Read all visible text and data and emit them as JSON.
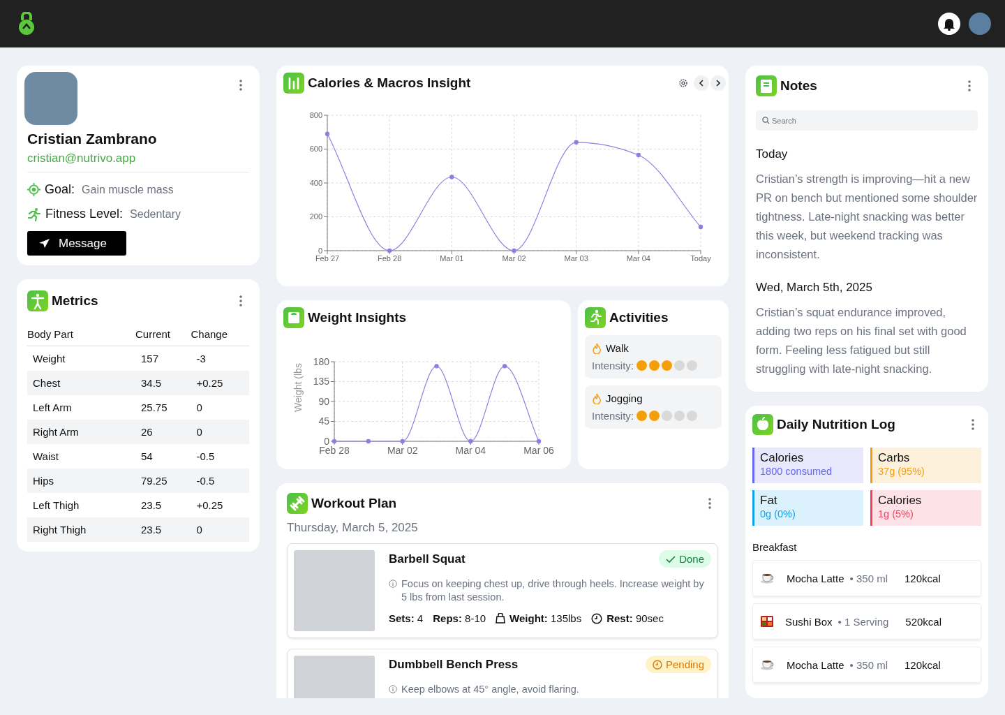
{
  "profile": {
    "name": "Cristian Zambrano",
    "email": "cristian@nutrivo.app",
    "attributes": [
      {
        "kind": "goal",
        "label": "Goal:",
        "value": "Gain muscle mass"
      },
      {
        "kind": "fitness",
        "label": "Fitness Level:",
        "value": "Sedentary"
      }
    ],
    "button": "Message"
  },
  "metrics": {
    "title": "Metrics",
    "columns": [
      "Body Part",
      "Current",
      "Change"
    ],
    "rows": [
      [
        "Weight",
        "157",
        "-3"
      ],
      [
        "Chest",
        "34.5",
        "+0.25"
      ],
      [
        "Left Arm",
        "25.75",
        "0"
      ],
      [
        "Right Arm",
        "26",
        "0"
      ],
      [
        "Waist",
        "54",
        "-0.5"
      ],
      [
        "Hips",
        "79.25",
        "-0.5"
      ],
      [
        "Left Thigh",
        "23.5",
        "+0.25"
      ],
      [
        "Right Thigh",
        "23.5",
        "0"
      ]
    ]
  },
  "calories_card": {
    "title": "Calories & Macros Insight",
    "chart_data": {
      "type": "line",
      "grid": true,
      "categories": [
        "Feb 27",
        "Feb 28",
        "Mar 01",
        "Mar 02",
        "Mar 03",
        "Mar 04",
        "Today"
      ],
      "ylim": [
        0,
        800
      ],
      "yticks": [
        0,
        200,
        400,
        600,
        800
      ],
      "series": [
        {
          "color": "#8b80e0",
          "marker": "circle",
          "values": [
            690,
            0,
            435,
            0,
            640,
            565,
            140
          ]
        }
      ]
    }
  },
  "weight_card": {
    "title": "Weight Insights",
    "chart_data": {
      "type": "line",
      "grid": true,
      "ylabel": "Weight (lbs",
      "categories": [
        "Feb 28",
        null,
        "Mar 02",
        null,
        "Mar 04",
        null,
        "Mar 06"
      ],
      "ylim": [
        0,
        180
      ],
      "yticks": [
        0,
        45,
        90,
        135,
        180
      ],
      "series": [
        {
          "color": "#8b80e0",
          "marker": "circle",
          "values": [
            0,
            0,
            0,
            170,
            0,
            170,
            0
          ]
        }
      ]
    }
  },
  "activities": {
    "title": "Activities",
    "items": [
      {
        "name": "Walk",
        "label": "Intensity:",
        "stars": 3
      },
      {
        "name": "Jogging",
        "label": "Intensity:",
        "stars": 2
      }
    ]
  },
  "workout": {
    "title": "Workout Plan",
    "date": "Thursday, March 5, 2025",
    "exercises": [
      {
        "name": "Barbell Squat",
        "kind": "done",
        "status": "Done",
        "note": "Focus on keeping chest up, drive through heels. Increase weight by 5 lbs from last session.",
        "stats": [
          {
            "kind": "plain",
            "label": "Sets:",
            "value": "4"
          },
          {
            "kind": "plain",
            "label": "Reps:",
            "value": "8-10"
          },
          {
            "kind": "weight",
            "label": "Weight:",
            "value": "135lbs"
          },
          {
            "kind": "time",
            "label": "Rest:",
            "value": "90sec"
          }
        ]
      },
      {
        "name": "Dumbbell Bench Press",
        "kind": "pending",
        "status": "Pending",
        "note": "Keep elbows at 45° angle, avoid flaring."
      }
    ]
  },
  "notes": {
    "title": "Notes",
    "search": {
      "placeholder": "Search"
    },
    "entries": [
      {
        "date": "Today",
        "text": "Cristian’s strength is improving—hit a new PR on bench but mentioned some shoulder tightness. Late-night snacking was better this week, but weekend tracking was inconsistent."
      },
      {
        "date": "Wed, March 5th, 2025",
        "text": "Cristian’s squat endurance improved, adding two reps on his final set with good form. Feeling less fatigued but still struggling with late-night snacking."
      }
    ]
  },
  "nutrition": {
    "title": "Daily Nutrition Log",
    "tiles": [
      {
        "label": "Calories",
        "value": "1800 consumed",
        "color": "#6366f1"
      },
      {
        "label": "Carbs",
        "value": "37g (95%)",
        "color": "#f59e0b"
      },
      {
        "label": "Fat",
        "value": "0g (0%)",
        "color": "#0ea5e9"
      },
      {
        "label": "Calories",
        "value": "1g (5%)",
        "color": "#f43f5e"
      }
    ],
    "meal": "Breakfast",
    "items": [
      {
        "kind": "coffee",
        "name": "Mocha Latte",
        "portion": "• 350 ml",
        "kcal": "120kcal"
      },
      {
        "kind": "bento",
        "name": "Sushi Box",
        "portion": "• 1 Serving",
        "kcal": "520kcal"
      },
      {
        "kind": "coffee",
        "name": "Mocha Latte",
        "portion": "• 350 ml",
        "kcal": "120kcal"
      }
    ]
  }
}
